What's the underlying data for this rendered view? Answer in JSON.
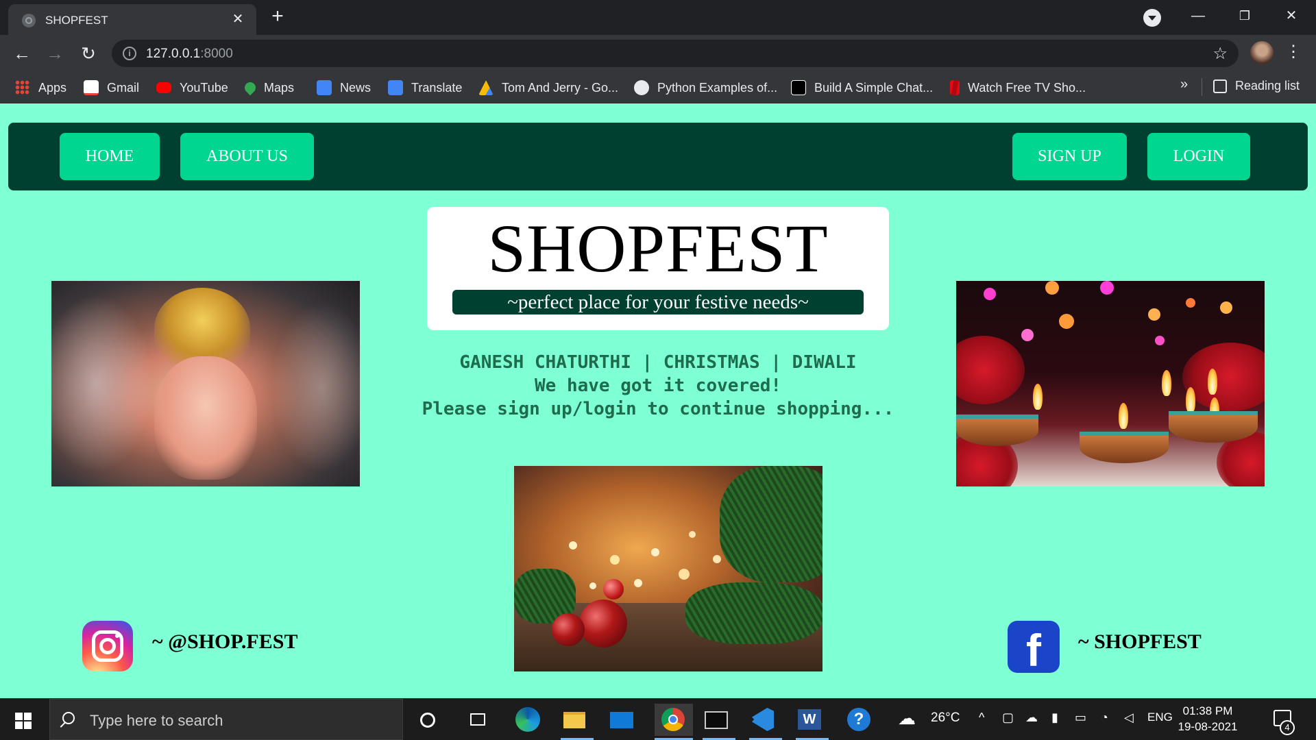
{
  "browser": {
    "tab_title": "SHOPFEST",
    "url_host": "127.0.0.1",
    "url_port": ":8000",
    "bookmarks": [
      "Apps",
      "Gmail",
      "YouTube",
      "Maps",
      "News",
      "Translate",
      "Tom And Jerry - Go...",
      "Python Examples of...",
      "Build A Simple Chat...",
      "Watch Free TV Sho..."
    ],
    "more_label": "»",
    "reading_list": "Reading list"
  },
  "navbar": {
    "home": "HOME",
    "about": "ABOUT US",
    "signup": "SIGN UP",
    "login": "LOGIN"
  },
  "brand": {
    "title": "SHOPFEST",
    "tagline": "~perfect place for your festive needs~"
  },
  "message": {
    "line1": "GANESH CHATURTHI | CHRISTMAS | DIWALI",
    "line2": "We have got it covered!",
    "line3": "Please sign up/login to continue shopping..."
  },
  "social": {
    "instagram": "~ @SHOP.FEST",
    "facebook": "~ SHOPFEST"
  },
  "taskbar": {
    "search_placeholder": "Type here to search",
    "weather": "26°C",
    "language": "ENG",
    "time": "01:38 PM",
    "date": "19-08-2021",
    "notification_count": "4"
  },
  "colors": {
    "page_bg": "#7fffd4",
    "navbar_bg": "#004030",
    "button_bg": "#00d68f",
    "message_text": "#1e6b4d"
  }
}
